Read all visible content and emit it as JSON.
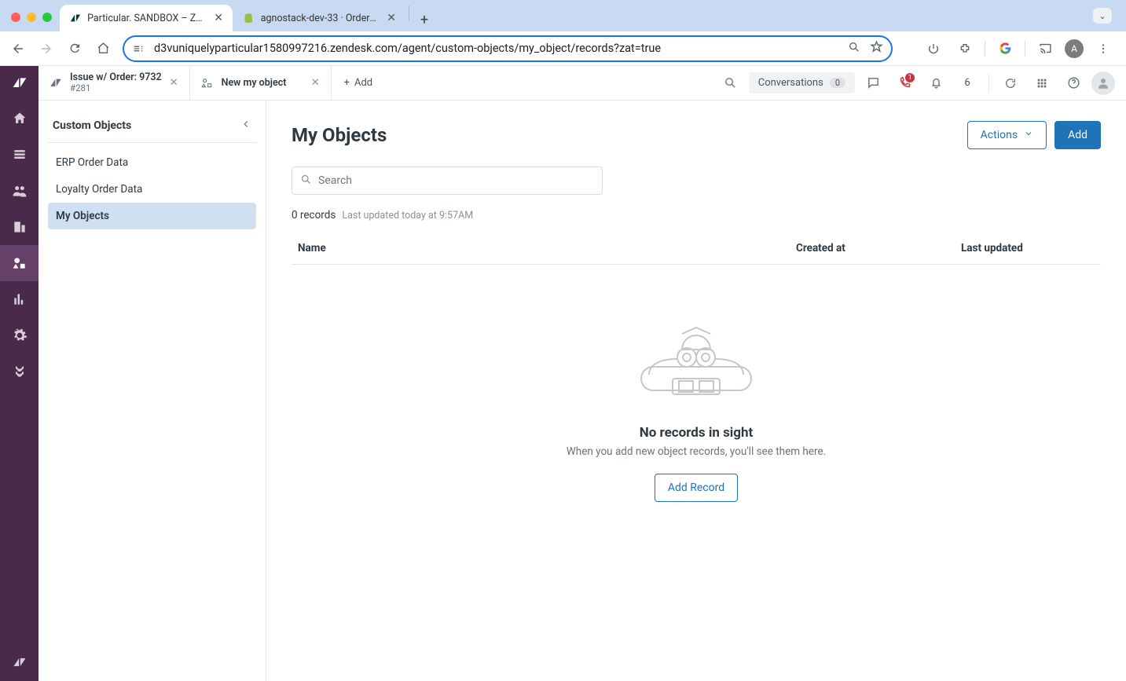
{
  "browser": {
    "tabs": [
      {
        "title": "Particular. SANDBOX – Zend",
        "active": true
      },
      {
        "title": "agnostack-dev-33 · Orders ·",
        "active": false
      }
    ],
    "url": "d3vuniquelyparticular1580997216.zendesk.com/agent/custom-objects/my_object/records?zat=true",
    "avatarLetter": "A"
  },
  "zendesk": {
    "tabs": [
      {
        "line1": "Issue w/ Order: 9732",
        "line2": "#281"
      },
      {
        "line1": "New my object"
      }
    ],
    "addLabel": "Add",
    "conversationsLabel": "Conversations",
    "conversationsCount": "0",
    "phoneBadge": "1",
    "notifNumber": "6"
  },
  "sidebar": {
    "title": "Custom Objects",
    "items": [
      {
        "label": "ERP Order Data",
        "active": false
      },
      {
        "label": "Loyalty Order Data",
        "active": false
      },
      {
        "label": "My Objects",
        "active": true
      }
    ]
  },
  "page": {
    "title": "My Objects",
    "actionsLabel": "Actions",
    "addLabel": "Add",
    "searchPlaceholder": "Search",
    "recordsCount": "0 records",
    "lastUpdated": "Last updated today at 9:57AM",
    "columns": {
      "name": "Name",
      "created": "Created at",
      "updated": "Last updated"
    },
    "empty": {
      "title": "No records in sight",
      "desc": "When you add new object records, you'll see them here.",
      "cta": "Add Record"
    }
  }
}
